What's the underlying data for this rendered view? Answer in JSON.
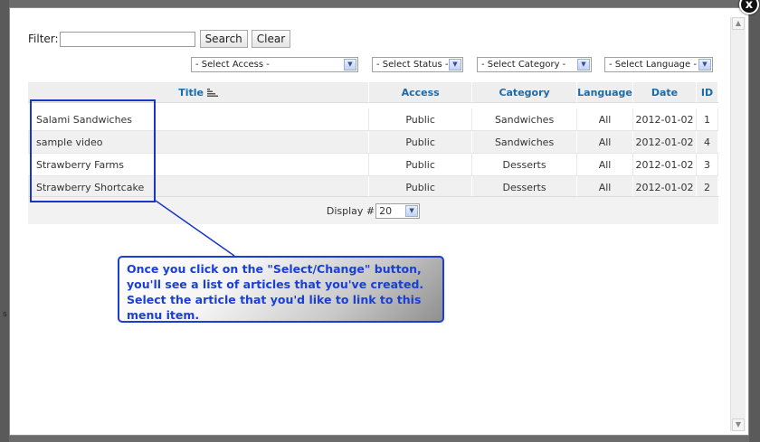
{
  "close": {
    "label": "x"
  },
  "filter": {
    "label": "Filter:",
    "value": "",
    "search_label": "Search",
    "clear_label": "Clear"
  },
  "selects": {
    "access": "- Select Access -",
    "status": "- Select Status -",
    "category": "- Select Category -",
    "language": "- Select Language -"
  },
  "table": {
    "headers": [
      "Title",
      "Access",
      "Category",
      "Language",
      "Date",
      "ID"
    ],
    "rows": [
      [
        "Salami Sandwiches",
        "Public",
        "Sandwiches",
        "All",
        "2012-01-02",
        "1"
      ],
      [
        "sample video",
        "Public",
        "Sandwiches",
        "All",
        "2012-01-02",
        "4"
      ],
      [
        "Strawberry Farms",
        "Public",
        "Desserts",
        "All",
        "2012-01-02",
        "3"
      ],
      [
        "Strawberry Shortcake",
        "Public",
        "Desserts",
        "All",
        "2012-01-02",
        "2"
      ]
    ]
  },
  "pagination": {
    "label": "Display #",
    "value": "20"
  },
  "callout": {
    "text": "Once you click on the \"Select/Change\" button, you'll see a list of articles that you've created. Select the article that you'd like to link to this menu item."
  },
  "colors": {
    "header_text": "#1d6ba5",
    "annotation_blue": "#1a3fd6"
  }
}
